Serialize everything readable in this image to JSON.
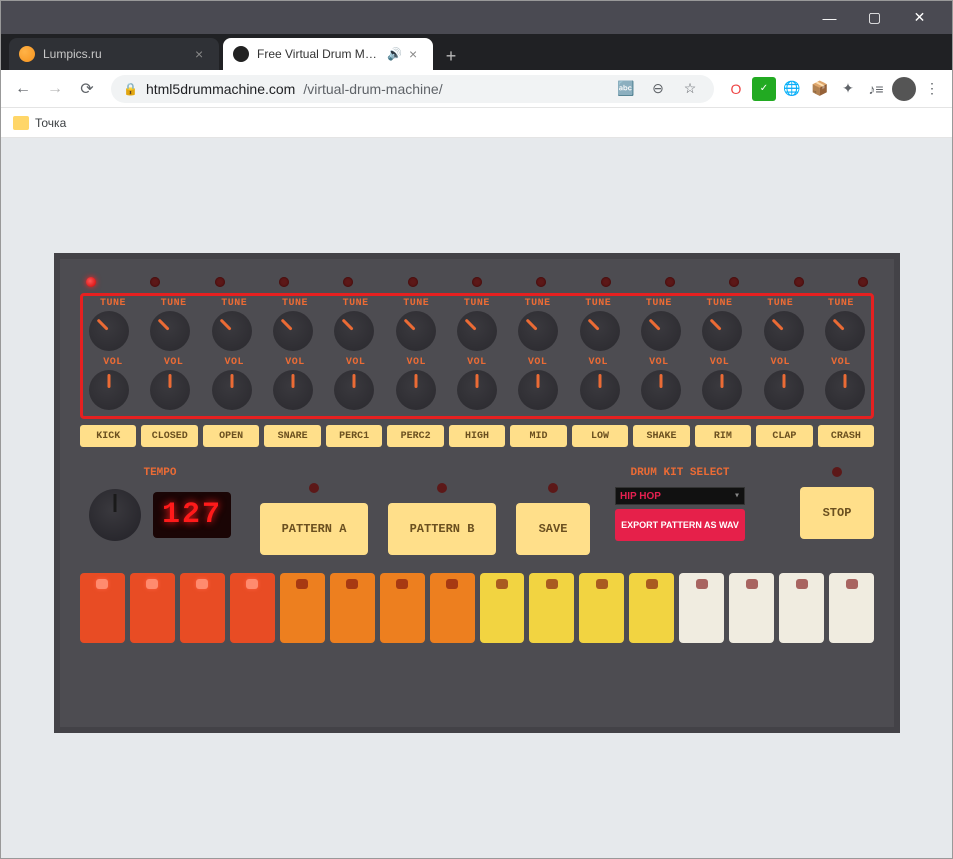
{
  "window": {
    "min": "—",
    "max": "▢",
    "close": "✕"
  },
  "tabs": [
    {
      "title": "Lumpics.ru",
      "active": false
    },
    {
      "title": "Free Virtual Drum Machine, U",
      "active": true,
      "audio": true
    }
  ],
  "nav": {
    "back": "←",
    "fwd": "→",
    "reload": "⟳"
  },
  "url": {
    "domain": "html5drummachine.com",
    "path": "/virtual-drum-machine/"
  },
  "toolbar_icons": [
    "⦿",
    "⌕",
    "☆",
    "O",
    "✓",
    "⊕",
    "⬢",
    "✦",
    "≡",
    "●",
    "⋮"
  ],
  "bookmark": {
    "label": "Точка"
  },
  "machine": {
    "tune_label": "TUNE",
    "vol_label": "VOL",
    "instruments": [
      "KICK",
      "CLOSED",
      "OPEN",
      "SNARE",
      "PERC1",
      "PERC2",
      "HIGH",
      "MID",
      "LOW",
      "SHAKE",
      "RIM",
      "CLAP",
      "CRASH"
    ],
    "tempo_label": "TEMPO",
    "tempo_value": "127",
    "pattern_a": "PATTERN A",
    "pattern_b": "PATTERN B",
    "save": "SAVE",
    "kit_label": "DRUM KIT SELECT",
    "kit_value": "HIP HOP",
    "export": "EXPORT PATTERN AS WAV",
    "stop": "STOP",
    "led_on_index": 0
  }
}
